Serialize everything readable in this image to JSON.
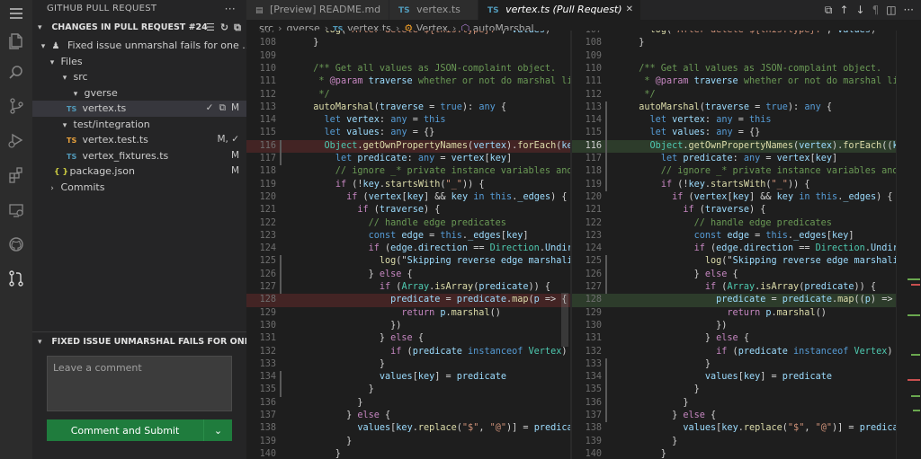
{
  "sidebar": {
    "title": "GITHUB PULL REQUEST",
    "more": "···",
    "changes_header": "CHANGES IN PULL REQUEST #24",
    "pr_title": "Fixed issue unmarshal fails for one ...",
    "files_label": "Files",
    "src_label": "src",
    "gverse_label": "gverse",
    "vertex_file": "vertex.ts",
    "vertex_status": "M",
    "test_folder": "test/integration",
    "test_file": "vertex.test.ts",
    "test_status": "M, ✓",
    "fixtures_file": "vertex_fixtures.ts",
    "fixtures_status": "M",
    "package_file": "package.json",
    "package_status": "M",
    "commits_label": "Commits",
    "review_header": "FIXED ISSUE UNMARSHAL FAILS FOR ONE TO ...",
    "comment_placeholder": "Leave a comment",
    "submit_label": "Comment and Submit"
  },
  "tabs": [
    {
      "label": "[Preview] README.md",
      "icon": "preview-icon"
    },
    {
      "label": "vertex.ts",
      "icon": "ts-icon"
    },
    {
      "label": "vertex.ts (Pull Request)",
      "icon": "ts-icon"
    }
  ],
  "breadcrumb": {
    "src": "src",
    "gverse": "gverse",
    "file": "vertex.ts",
    "class": "Vertex",
    "method": "autoMarshal"
  },
  "icons": {
    "ts": "TS",
    "json": "{ }"
  },
  "colors": {
    "keyword": "#569cd6",
    "control": "#c586c0",
    "string": "#ce9178",
    "comment": "#6a9955",
    "function": "#dcdcaa",
    "variable": "#9cdcfe",
    "type": "#4ec9b0",
    "accent_green": "#1f7c3d"
  },
  "editor": {
    "left_lines": [
      {
        "n": "107",
        "text": "    log(`After delete ${this.type}:`, values)"
      },
      {
        "n": "108",
        "text": "  }"
      },
      {
        "n": "109",
        "text": ""
      },
      {
        "n": "110",
        "text": "  /** Get all values as JSON-complaint object."
      },
      {
        "n": "111",
        "text": "   * @param traverse whether or not do marshal linked"
      },
      {
        "n": "112",
        "text": "   */"
      },
      {
        "n": "113",
        "text": "  autoMarshal(traverse = true): any {"
      },
      {
        "n": "114",
        "text": "    let vertex: any = this"
      },
      {
        "n": "115",
        "text": "    let values: any = {}"
      },
      {
        "n": "116",
        "text": "    Object.getOwnPropertyNames(vertex).forEach(key =>"
      },
      {
        "n": "117",
        "text": "      let predicate: any = vertex[key]"
      },
      {
        "n": "118",
        "text": "      // ignore _* private instance variables and spec"
      },
      {
        "n": "119",
        "text": "      if (!key.startsWith(\"_\")) {"
      },
      {
        "n": "120",
        "text": "        if (vertex[key] && key in this._edges) {"
      },
      {
        "n": "121",
        "text": "          if (traverse) {"
      },
      {
        "n": "122",
        "text": "            // handle edge predicates"
      },
      {
        "n": "123",
        "text": "            const edge = this._edges[key]"
      },
      {
        "n": "124",
        "text": "            if (edge.direction == Direction.Undirected"
      },
      {
        "n": "125",
        "text": "              log(\"Skipping reverse edge marshaling fo"
      },
      {
        "n": "126",
        "text": "            } else {"
      },
      {
        "n": "127",
        "text": "              if (Array.isArray(predicate)) {"
      },
      {
        "n": "128",
        "text": "                predicate = predicate.map(p => {"
      },
      {
        "n": "129",
        "text": "                  return p.marshal()"
      },
      {
        "n": "130",
        "text": "                })"
      },
      {
        "n": "131",
        "text": "              } else {"
      },
      {
        "n": "132",
        "text": "                if (predicate instanceof Vertex) predi"
      },
      {
        "n": "133",
        "text": "              }"
      },
      {
        "n": "134",
        "text": "              values[key] = predicate"
      },
      {
        "n": "135",
        "text": "            }"
      },
      {
        "n": "136",
        "text": "          }"
      },
      {
        "n": "137",
        "text": "        } else {"
      },
      {
        "n": "138",
        "text": "          values[key.replace(\"$\", \"@\")] = predicate"
      },
      {
        "n": "139",
        "text": "        }"
      },
      {
        "n": "140",
        "text": "      }"
      }
    ],
    "right_lines": [
      {
        "n": "107",
        "text": "    log(`After delete ${this.type}:`, values)"
      },
      {
        "n": "108",
        "text": "  }"
      },
      {
        "n": "109",
        "text": ""
      },
      {
        "n": "110",
        "text": "  /** Get all values as JSON-complaint object."
      },
      {
        "n": "111",
        "text": "   * @param traverse whether or not do marshal linked"
      },
      {
        "n": "112",
        "text": "   */"
      },
      {
        "n": "113",
        "text": "  autoMarshal(traverse = true): any {"
      },
      {
        "n": "114",
        "text": "    let vertex: any = this"
      },
      {
        "n": "115",
        "text": "    let values: any = {}"
      },
      {
        "n": "116",
        "text": "    Object.getOwnPropertyNames(vertex).forEach((key) ="
      },
      {
        "n": "117",
        "text": "      let predicate: any = vertex[key]"
      },
      {
        "n": "118",
        "text": "      // ignore _* private instance variables and spec"
      },
      {
        "n": "119",
        "text": "      if (!key.startsWith(\"_\")) {"
      },
      {
        "n": "120",
        "text": "        if (vertex[key] && key in this._edges) {"
      },
      {
        "n": "121",
        "text": "          if (traverse) {"
      },
      {
        "n": "122",
        "text": "            // handle edge predicates"
      },
      {
        "n": "123",
        "text": "            const edge = this._edges[key]"
      },
      {
        "n": "124",
        "text": "            if (edge.direction == Direction.Undirected"
      },
      {
        "n": "125",
        "text": "              log(\"Skipping reverse edge marshaling fo"
      },
      {
        "n": "126",
        "text": "            } else {"
      },
      {
        "n": "127",
        "text": "              if (Array.isArray(predicate)) {"
      },
      {
        "n": "128",
        "text": "                predicate = predicate.map((p) => {"
      },
      {
        "n": "129",
        "text": "                  return p.marshal()"
      },
      {
        "n": "130",
        "text": "                })"
      },
      {
        "n": "131",
        "text": "              } else {"
      },
      {
        "n": "132",
        "text": "                if (predicate instanceof Vertex) predi"
      },
      {
        "n": "133",
        "text": "              }"
      },
      {
        "n": "134",
        "text": "              values[key] = predicate"
      },
      {
        "n": "135",
        "text": "            }"
      },
      {
        "n": "136",
        "text": "          }"
      },
      {
        "n": "137",
        "text": "        } else {"
      },
      {
        "n": "138",
        "text": "          values[key.replace(\"$\", \"@\")] = predicate"
      },
      {
        "n": "139",
        "text": "        }"
      },
      {
        "n": "140",
        "text": "      }"
      }
    ],
    "changed_lines": [
      "116",
      "128"
    ],
    "current_line": "116"
  }
}
